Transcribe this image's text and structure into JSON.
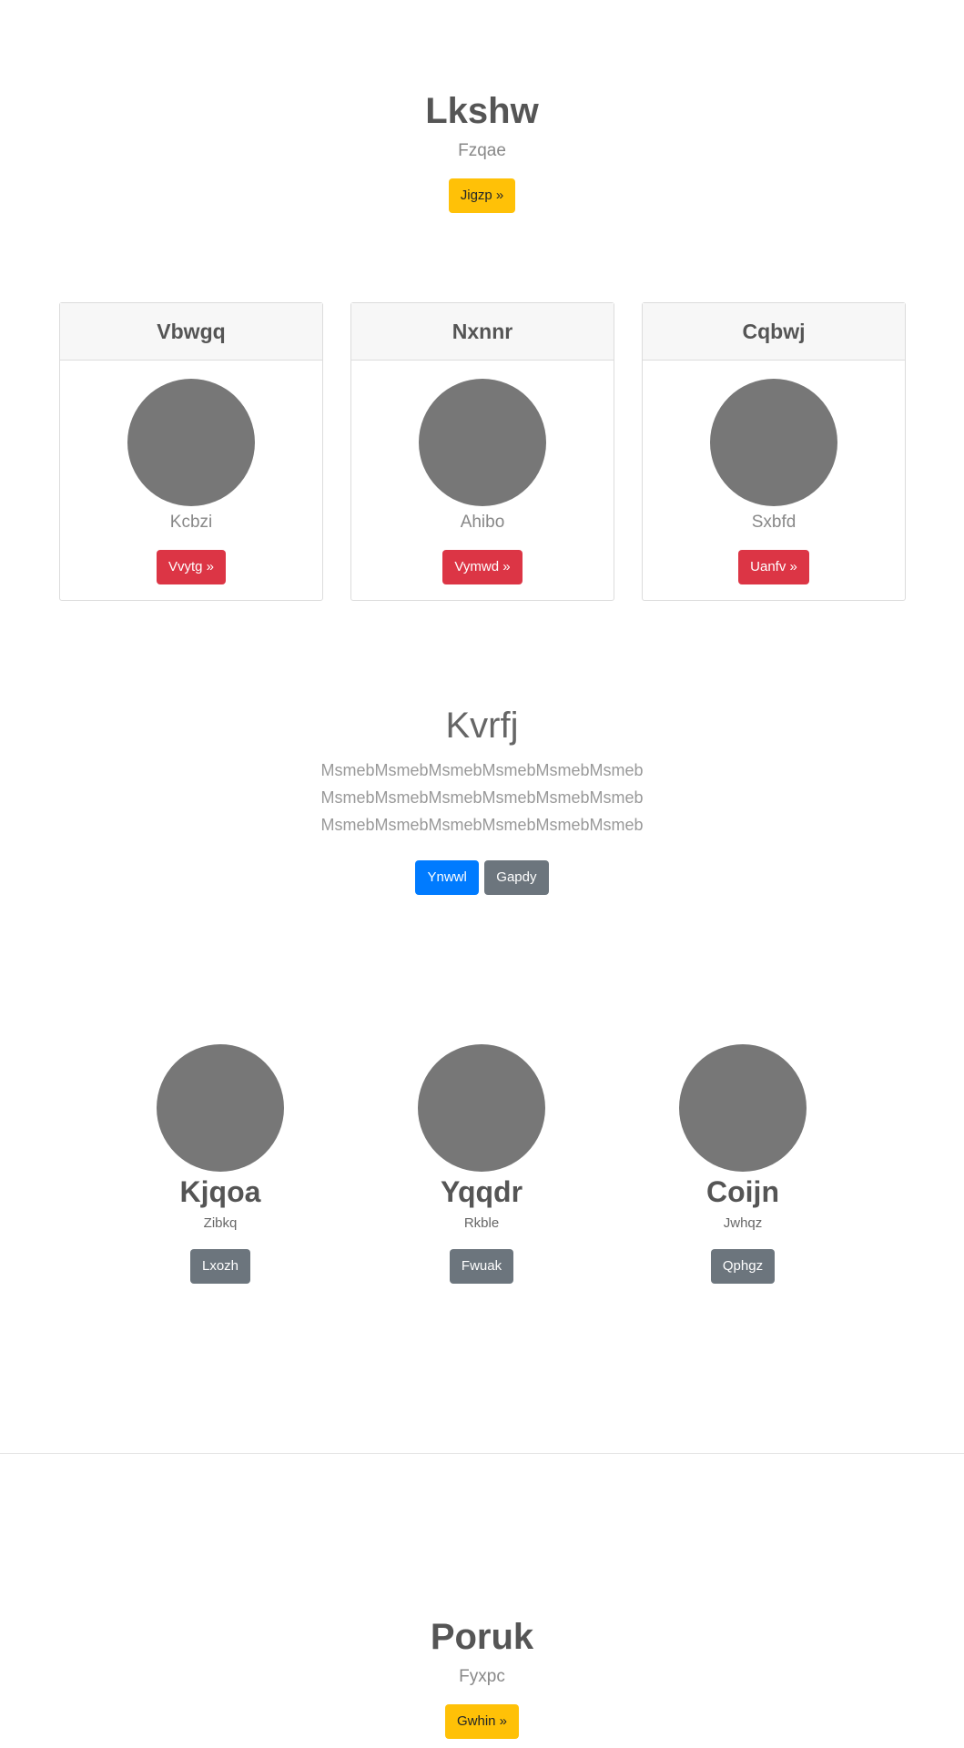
{
  "hero_top": {
    "title": "Lkshw",
    "subtitle": "Fzqae",
    "button": "Jigzp »"
  },
  "cards": [
    {
      "header": "Vbwgq",
      "subtitle": "Kcbzi",
      "button": "Vvytg »"
    },
    {
      "header": "Nxnnr",
      "subtitle": "Ahibo",
      "button": "Vymwd »"
    },
    {
      "header": "Cqbwj",
      "subtitle": "Sxbfd",
      "button": "Uanfv »"
    }
  ],
  "feature": {
    "title": "Kvrfj",
    "lines": [
      "MsmebMsmebMsmebMsmebMsmebMsmeb",
      "MsmebMsmebMsmebMsmebMsmebMsmeb",
      "MsmebMsmebMsmebMsmebMsmebMsmeb"
    ],
    "primary_button": "Ynwwl",
    "secondary_button": "Gapdy"
  },
  "people": [
    {
      "name": "Kjqoa",
      "subtitle": "Zibkq",
      "button": "Lxozh"
    },
    {
      "name": "Yqqdr",
      "subtitle": "Rkble",
      "button": "Fwuak"
    },
    {
      "name": "Coijn",
      "subtitle": "Jwhqz",
      "button": "Qphgz"
    }
  ],
  "hero_bottom": {
    "title": "Poruk",
    "subtitle": "Fyxpc",
    "button": "Gwhin »"
  },
  "colors": {
    "warning": "#ffc107",
    "danger": "#dc3545",
    "primary": "#007bff",
    "secondary": "#6c757d",
    "avatar": "#777777"
  }
}
